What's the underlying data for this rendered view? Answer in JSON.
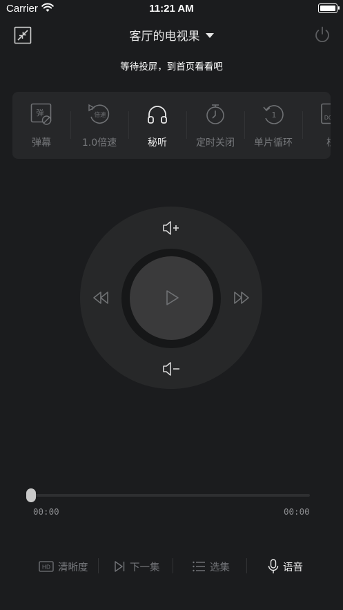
{
  "status_bar": {
    "carrier": "Carrier",
    "time": "11:21 AM"
  },
  "header": {
    "title": "客厅的电视果",
    "subtitle": "等待投屏，到首页看看吧"
  },
  "functions": [
    {
      "label": "弹幕",
      "icon": "danmaku-off-icon",
      "icon_text": "弹"
    },
    {
      "label": "1.0倍速",
      "icon": "playback-speed-icon",
      "icon_text": "倍速"
    },
    {
      "label": "秘听",
      "icon": "headphones-icon",
      "active": true
    },
    {
      "label": "定时关闭",
      "icon": "timer-icon"
    },
    {
      "label": "单片循环",
      "icon": "repeat-one-icon",
      "icon_text": "1"
    },
    {
      "label": "杜",
      "icon": "dolby-icon",
      "icon_text": "DO"
    }
  ],
  "remote": {
    "volume_up": "volume-up-icon",
    "volume_down": "volume-down-icon",
    "rewind": "rewind-icon",
    "forward": "fast-forward-icon",
    "play": "play-icon"
  },
  "progress": {
    "current": "00:00",
    "total": "00:00",
    "fraction": 0
  },
  "bottom_bar": {
    "quality_badge": "HD",
    "quality": "清晰度",
    "next": "下一集",
    "episodes": "选集",
    "voice": "语音"
  }
}
